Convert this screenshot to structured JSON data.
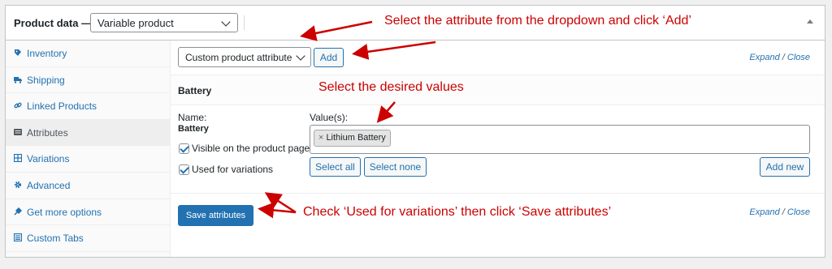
{
  "panel": {
    "title": "Product data —",
    "product_type": "Variable product",
    "tabs": [
      {
        "label": "Inventory",
        "icon": "inventory-icon",
        "active": false
      },
      {
        "label": "Shipping",
        "icon": "truck-icon",
        "active": false
      },
      {
        "label": "Linked Products",
        "icon": "link-icon",
        "active": false
      },
      {
        "label": "Attributes",
        "icon": "list-icon",
        "active": true
      },
      {
        "label": "Variations",
        "icon": "grid-icon",
        "active": false
      },
      {
        "label": "Advanced",
        "icon": "gear-icon",
        "active": false
      },
      {
        "label": "Get more options",
        "icon": "plugin-icon",
        "active": false
      },
      {
        "label": "Custom Tabs",
        "icon": "tabs-icon",
        "active": false
      }
    ]
  },
  "attributes": {
    "select_value": "Custom product attribute",
    "add_label": "Add",
    "expand_label": "Expand",
    "slash": "/",
    "close_label": "Close",
    "attribute_header": "Battery",
    "name_label": "Name:",
    "name_value": "Battery",
    "visible_label": "Visible on the product page",
    "visible_checked": true,
    "variations_label": "Used for variations",
    "variations_checked": true,
    "values_label": "Value(s):",
    "values": [
      {
        "remove": "×",
        "label": "Lithium Battery"
      }
    ],
    "select_all_label": "Select all",
    "select_none_label": "Select none",
    "add_new_label": "Add new",
    "save_label": "Save attributes"
  },
  "annotations": {
    "top": "Select the attribute from the dropdown and click ‘Add’",
    "middle": "Select the desired values",
    "bottom": "Check ‘Used for variations’ then click ‘Save attributes’",
    "color": "#cc0000"
  }
}
